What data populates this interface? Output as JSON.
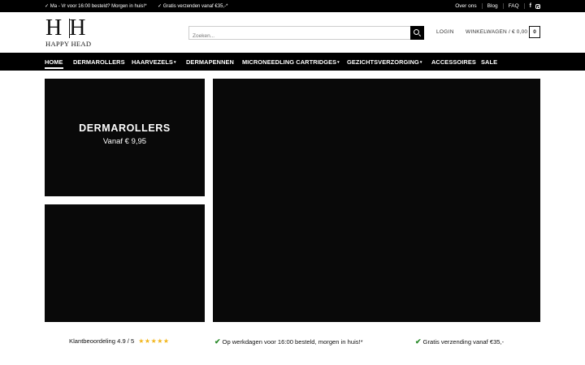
{
  "topbar": {
    "msg1": "✓ Ma - Vr voor 16:00 besteld? Morgen in huis!*",
    "msg2": "✓ Gratis verzenden vanaf €35,-*",
    "links": [
      "Over ons",
      "Blog",
      "FAQ"
    ],
    "social": [
      "facebook-icon",
      "instagram-icon"
    ]
  },
  "header": {
    "logo_monogram": "H|H",
    "logo_text": "HAPPY HEAD",
    "search_placeholder": "Zoeken...",
    "login_label": "LOGIN",
    "cart_label": "WINKELWAGEN / € 0,00",
    "cart_count": "0"
  },
  "nav": {
    "items": [
      {
        "label": "HOME",
        "dropdown": false
      },
      {
        "label": "DERMAROLLERS",
        "dropdown": false
      },
      {
        "label": "HAARVEZELS",
        "dropdown": true
      },
      {
        "label": "DERMAPENNEN",
        "dropdown": false
      },
      {
        "label": "MICRONEEDLING CARTRIDGES",
        "dropdown": true
      },
      {
        "label": "GEZICHTSVERZORGING",
        "dropdown": true
      },
      {
        "label": "ACCESSOIRES",
        "dropdown": false
      },
      {
        "label": "SALE",
        "dropdown": false
      }
    ]
  },
  "hero": {
    "tile_title": "DERMAROLLERS",
    "tile_subtitle": "Vanaf € 9,95"
  },
  "usps": {
    "rating": "Klantbeoordeling 4.9 / 5",
    "stars": "★★★★★",
    "delivery": "Op werkdagen voor 16:00 besteld, morgen in huis!*",
    "shipping": "Gratis verzending vanaf €35,-"
  },
  "colors": {
    "bar": "#000000",
    "tile": "#090909",
    "star": "#f2b61c",
    "check": "#2a8a2a"
  }
}
